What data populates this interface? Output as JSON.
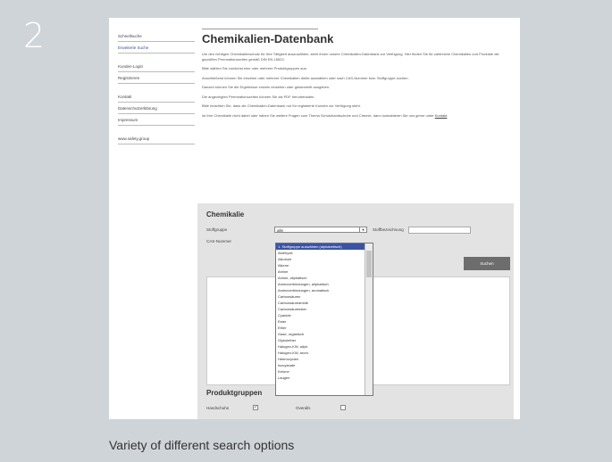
{
  "step": {
    "number": "2"
  },
  "caption": "Variety of different search options",
  "sidebar": {
    "groups": [
      [
        "Schnellsuche",
        "Erweiterte Suche"
      ],
      [
        "Kunden-Login",
        "Registrieren"
      ],
      [
        "Kontakt",
        "Datenschutzerklärung",
        "Impressum"
      ],
      [
        "www.safety.group"
      ]
    ],
    "active_item": "Erweiterte Suche"
  },
  "main": {
    "title": "Chemikalien-Datenbank",
    "paragraphs": [
      "Um den richtigen Chemikalienschutz für Ihre Tätigkeit auszuwählen, steht Ihnen unsere Chemikalien-Datenbank zur Verfügung. Hier finden Sie für zahlreiche Chemikalien und Produkte die geprüften Permeationszeiten gemäß DIN EN 16523.",
      "Bitte wählen Sie zunächst eine oder mehrere Produktgruppen aus.",
      "Anschließend können Sie einzelne oder mehrere Chemikalien direkt auswählen oder nach CAS-Nummer bzw. Stoffgruppe suchen.",
      "Danach können Sie die Ergebnisse einzeln einsehen oder gesammelt ausgeben.",
      "Die angezeigten Permeationszeiten können Sie als PDF herunterladen.",
      "Bitte beachten Sie, dass die Chemikalien-Datenbank nur für registrierte Kunden zur Verfügung steht.",
      "Ist Ihre Chemikalie nicht dabei oder haben Sie weitere Fragen zum Thema Schutzhandschuhe und Chemie, dann kontaktieren Sie uns gerne unter"
    ],
    "contact_link": "Kontakt"
  },
  "search": {
    "panel_title": "Chemikalie",
    "stoffgruppe_label": "Stoffgruppe",
    "stoffgruppe_value": "alle",
    "bezeichnung_label": "Stoffbezeichnung",
    "cas_label": "CAS-Nummer",
    "search_button": "Suchen",
    "dropdown_items": [
      "1. Stoffgruppe auswählen (alphabetisch)",
      "Aldehyde",
      "Alkohole",
      "Alkene",
      "Amine",
      "Amine, aliphatisch",
      "Aminoverbindungen, aliphatisch",
      "Aminoverbindungen, aromatisch",
      "Carbonsäuren",
      "Carbonsäureamide",
      "Carbonsäureester",
      "Cyanide",
      "Ester",
      "Ether",
      "Gase, organisch",
      "Glykolether",
      "Halogen-KW, aliph.",
      "Halogen-KW, arom.",
      "Heterocyclen",
      "Isocyanate",
      "Ketone",
      "Laugen"
    ]
  },
  "products": {
    "title": "Produktgruppen",
    "options": [
      {
        "label": "Handschuhe",
        "checked": true
      },
      {
        "label": "Overalls",
        "checked": false
      }
    ]
  }
}
